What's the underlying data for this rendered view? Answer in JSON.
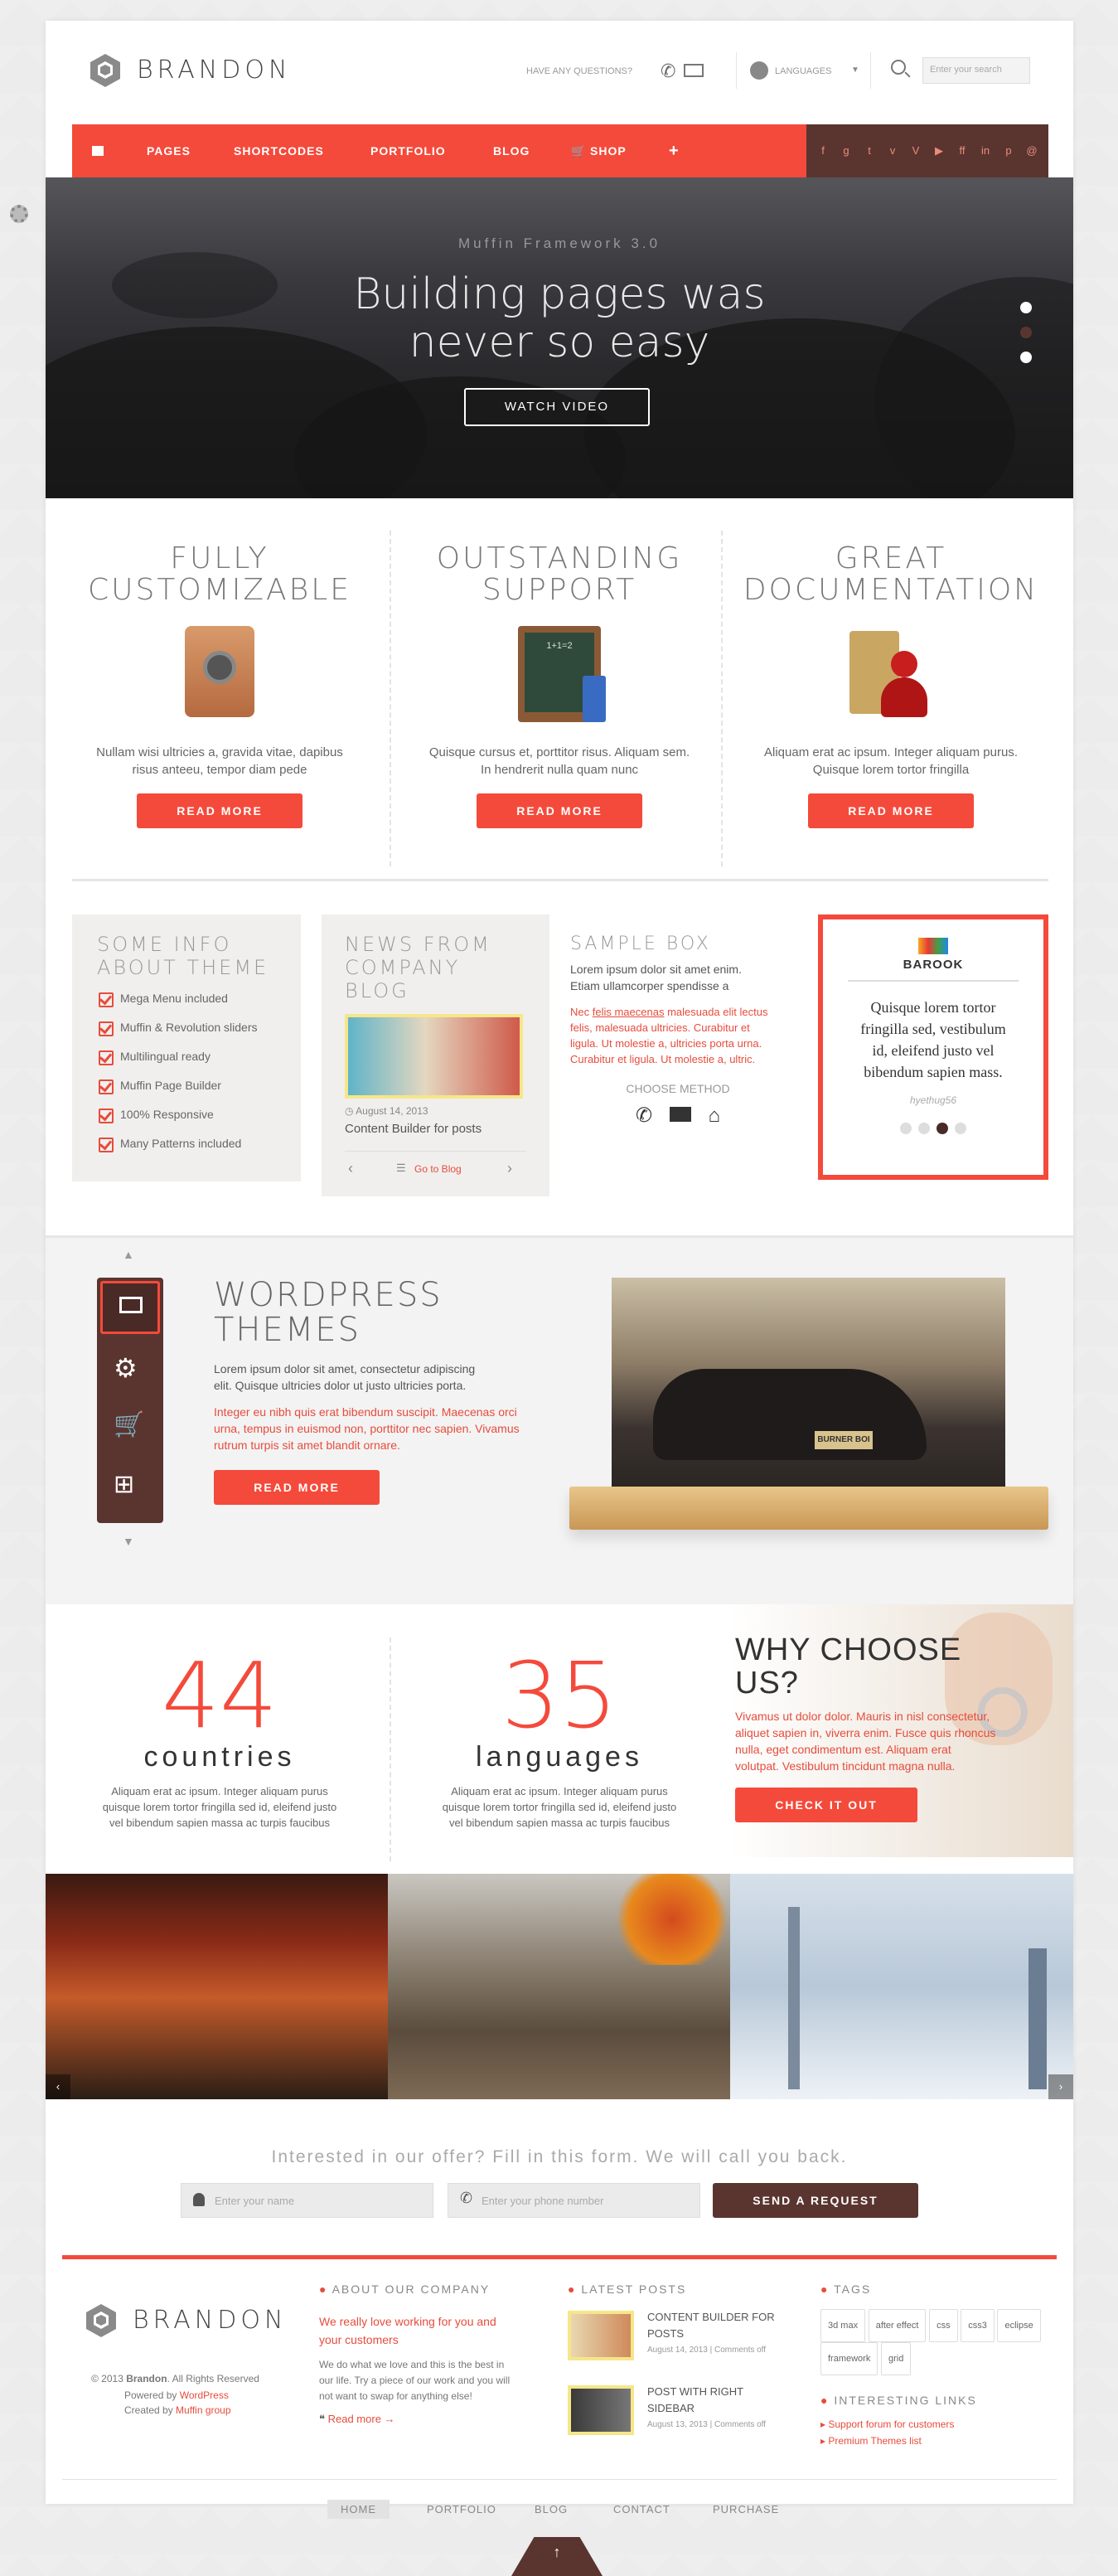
{
  "brand": {
    "name": "BRANDON"
  },
  "header": {
    "questions": "HAVE ANY QUESTIONS?",
    "languages": "LANGUAGES",
    "search_placeholder": "Enter your search"
  },
  "nav": {
    "items": [
      "PAGES",
      "SHORTCODES",
      "PORTFOLIO",
      "BLOG",
      "SHOP"
    ],
    "plus": "+",
    "social": [
      "f",
      "g",
      "t",
      "v",
      "V",
      "in",
      "ff",
      "in",
      "p",
      "@"
    ]
  },
  "hero": {
    "subtitle": "Muffin Framework 3.0",
    "title_line1": "Building pages was",
    "title_line2": "never so easy",
    "button": "WATCH VIDEO"
  },
  "features": [
    {
      "title1": "FULLY",
      "title2": "CUSTOMIZABLE",
      "text1": "Nullam wisi ultricies a, gravida vitae, dapibus",
      "text2": "risus anteeu, tempor diam pede",
      "button": "READ MORE"
    },
    {
      "title1": "OUTSTANDING",
      "title2": "SUPPORT",
      "text1": "Quisque cursus et, porttitor risus. Aliquam sem.",
      "text2": "In hendrerit nulla quam nunc",
      "button": "READ MORE"
    },
    {
      "title1": "GREAT",
      "title2": "DOCUMENTATION",
      "text1": "Aliquam erat ac ipsum. Integer aliquam purus.",
      "text2": "Quisque lorem tortor fringilla",
      "button": "READ MORE"
    }
  ],
  "info": {
    "title1": "SOME INFO",
    "title2": "ABOUT THEME",
    "items": [
      "Mega Menu included",
      "Muffin & Revolution sliders",
      "Multilingual ready",
      "Muffin Page Builder",
      "100% Responsive",
      "Many Patterns included"
    ]
  },
  "news": {
    "title1": "NEWS FROM",
    "title2": "COMPANY BLOG",
    "date": "August 14, 2013",
    "post": "Content Builder for posts",
    "go": "Go to Blog"
  },
  "sample": {
    "title": "SAMPLE BOX",
    "text1": "Lorem ipsum dolor sit amet enim.",
    "text2": "Etiam ullamcorper spendisse a",
    "text3a": "Nec ",
    "text3b": "felis maecenas",
    "text3c": " malesuada elit lectus",
    "text4": "felis, malesuada ultricies. Curabitur et",
    "text5": "ligula. Ut molestie a, ultricies porta urna.",
    "text6": "Curabitur et ligula. Ut molestie a, ultric.",
    "method": "CHOOSE METHOD"
  },
  "testimonial": {
    "brand": "BAROOK",
    "quote1": "Quisque lorem tortor",
    "quote2": "fringilla sed, vestibulum",
    "quote3": "id, eleifend justo vel",
    "quote4": "bibendum sapien mass.",
    "author": "hyethug56"
  },
  "wp": {
    "title1": "WORDPRESS",
    "title2": "THEMES",
    "text1": "Lorem ipsum dolor sit amet, consectetur adipiscing",
    "text2": "elit. Quisque ultricies dolor ut justo ultricies porta.",
    "text3": "Integer eu nibh quis erat bibendum suscipit. Maecenas orci",
    "text4": "urna, tempus in euismod non, porttitor nec sapien. Vivamus",
    "text5": "rutrum turpis sit amet blandit ornare.",
    "button": "READ MORE",
    "plate": "BURNER BOI"
  },
  "counters": [
    {
      "num": "44",
      "label": "countries",
      "t1": "Aliquam erat ac ipsum. Integer aliquam purus",
      "t2": "quisque lorem tortor fringilla sed id, eleifend justo",
      "t3": "vel bibendum sapien massa ac turpis faucibus"
    },
    {
      "num": "35",
      "label": "languages",
      "t1": "Aliquam erat ac ipsum. Integer aliquam purus",
      "t2": "quisque lorem tortor fringilla sed id, eleifend justo",
      "t3": "vel bibendum sapien massa ac turpis faucibus"
    }
  ],
  "why": {
    "title1": "WHY CHOOSE",
    "title2": "US?",
    "t1": "Vivamus ut dolor dolor. Mauris in nisl consectetur,",
    "t2": "aliquet sapien in, viverra enim. Fusce quis rhoncus",
    "t3": "nulla, eget condimentum est. Aliquam erat",
    "t4": "volutpat. Vestibulum tincidunt magna nulla.",
    "button": "CHECK IT OUT"
  },
  "form": {
    "title": "Interested in our offer? Fill in this form. We will call you back.",
    "name": "Enter your name",
    "phone": "Enter your phone number",
    "button": "SEND A REQUEST"
  },
  "footer": {
    "copy_pre": "© 2013 ",
    "copy_brand": "Brandon",
    "copy_post": ". All Rights Reserved",
    "powered_pre": "Powered by ",
    "powered": "WordPress",
    "created_pre": "Created by ",
    "created": "Muffin group",
    "about_head": "ABOUT OUR COMPANY",
    "about1": "We really love working for you and",
    "about2": "your customers",
    "about3": "We do what we love and this is the best in",
    "about4": "our life. Try a piece of our work and you will",
    "about5": "not want to swap for anything else!",
    "readmore": "Read more →",
    "posts_head": "LATEST POSTS",
    "posts": [
      {
        "t1": "CONTENT BUILDER FOR",
        "t2": "POSTS",
        "date": "August 14, 2013 | ",
        "comments": "Comments off"
      },
      {
        "t1": "POST WITH RIGHT",
        "t2": "SIDEBAR",
        "date": "August 13, 2013 | ",
        "comments": "Comments off"
      }
    ],
    "tags_head": "TAGS",
    "tags": [
      "3d max",
      "after effect",
      "css",
      "css3",
      "eclipse",
      "framework",
      "grid"
    ],
    "links_head": "INTERESTING LINKS",
    "links": [
      "Support forum for customers",
      "Premium Themes list"
    ],
    "nav": [
      "HOME",
      "PORTFOLIO",
      "BLOG",
      "CONTACT",
      "PURCHASE"
    ]
  }
}
